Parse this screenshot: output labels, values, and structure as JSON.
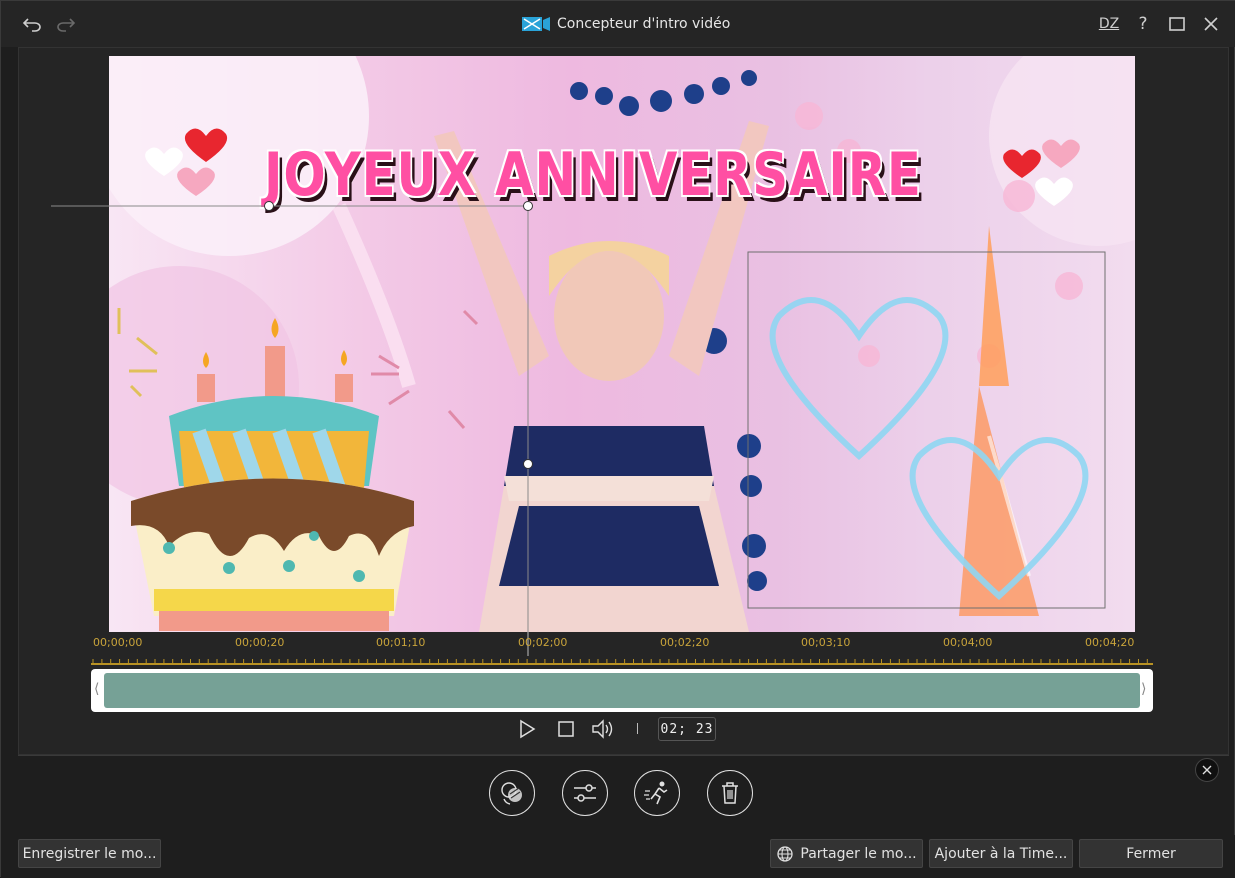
{
  "window": {
    "title": "Concepteur d'intro vidéo"
  },
  "titlebar": {
    "undo_icon": "undo-icon",
    "redo_icon": "redo-icon",
    "dz_label": "DZ",
    "help_label": "?"
  },
  "preview": {
    "headline": "JOYEUX ANNIVERSAIRE"
  },
  "ruler": {
    "ticks": [
      "00;00;00",
      "00;00;20",
      "00;01;10",
      "00;02;00",
      "00;02;20",
      "00;03;10",
      "00;04;00",
      "00;04;20"
    ]
  },
  "track": {
    "left_handle": "⟨",
    "right_handle": "⟩"
  },
  "playback": {
    "timecode": "02; 23"
  },
  "tools": [
    "effects-icon",
    "adjust-sliders-icon",
    "motion-icon",
    "trash-icon"
  ],
  "buttons": {
    "save": "Enregistrer le mo...",
    "share": "Partager le mo...",
    "add_timeline": "Ajouter à la Time...",
    "close": "Fermer"
  },
  "colors": {
    "accent_gold": "#c9a43a",
    "clip_green": "#76a196",
    "title_pink": "#ff4fa3"
  }
}
